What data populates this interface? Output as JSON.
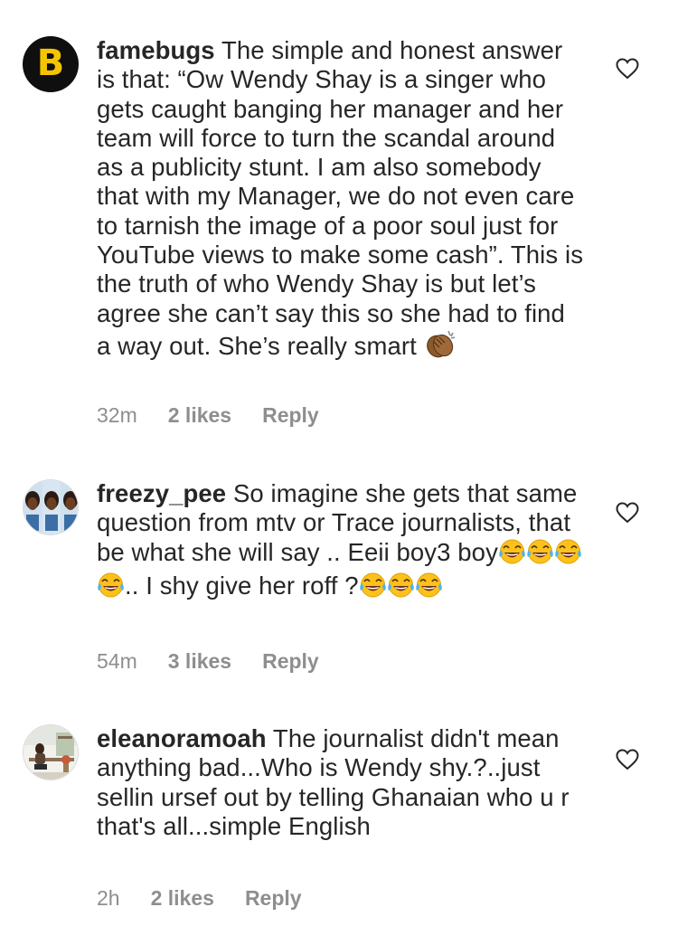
{
  "comments": [
    {
      "username": "famebugs",
      "avatar_letter": "B",
      "text": "The simple and honest answer is that: “Ow Wendy Shay is a singer who gets  caught banging her manager and her team will force to turn the scandal around as a publicity stunt. I am also somebody that with my Manager, we do not even care to tarnish the image of a poor soul just for YouTube views to make some cash”. This is the truth of who Wendy Shay is but let’s agree she can’t say this so she had to find a way out. She’s really smart",
      "trailing_emoji": "clapping-hands-dark-skin",
      "time": "32m",
      "likes": "2 likes",
      "reply": "Reply",
      "like_icon": "heart-outline-icon"
    },
    {
      "username": "freezy_pee",
      "text_line_1": "So imagine she gets that same question from mtv or Trace journalists, that be what she will say .. Eeii boy3 boy",
      "text_line_2": ".. I shy give her roff ?",
      "emoji_group_1_count": 4,
      "emoji_group_2_count": 3,
      "emoji_name": "face-with-tears-of-joy",
      "time": "54m",
      "likes": "3 likes",
      "reply": "Reply",
      "like_icon": "heart-outline-icon"
    },
    {
      "username": "eleanoramoah",
      "text": "The journalist didn't mean anything bad...Who is Wendy shy.?..just sellin ursef out by telling Ghanaian who u r that's all...simple English",
      "time": "2h",
      "likes": "2 likes",
      "reply": "Reply",
      "like_icon": "heart-outline-icon"
    }
  ],
  "colors": {
    "text": "#262626",
    "meta": "#8e8e8e",
    "avatar_bg": "#0f0f0f",
    "avatar_letter": "#f5c400"
  }
}
